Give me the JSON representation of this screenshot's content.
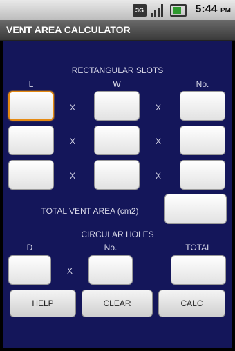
{
  "status_bar": {
    "network": "3G",
    "time": "5:44",
    "ampm": "PM"
  },
  "app": {
    "title": "VENT AREA CALCULATOR"
  },
  "rect": {
    "heading": "RECTANGULAR SLOTS",
    "col_l": "L",
    "col_w": "W",
    "col_no": "No.",
    "times": "X",
    "total_label": "TOTAL VENT AREA (cm2)"
  },
  "circ": {
    "heading": "CIRCULAR HOLES",
    "col_d": "D",
    "col_no": "No.",
    "col_total": "TOTAL",
    "times": "X",
    "equals": "="
  },
  "buttons": {
    "help": "HELP",
    "clear": "CLEAR",
    "calc": "CALC"
  },
  "colors": {
    "background": "#14165a",
    "focus": "#e58a12"
  }
}
